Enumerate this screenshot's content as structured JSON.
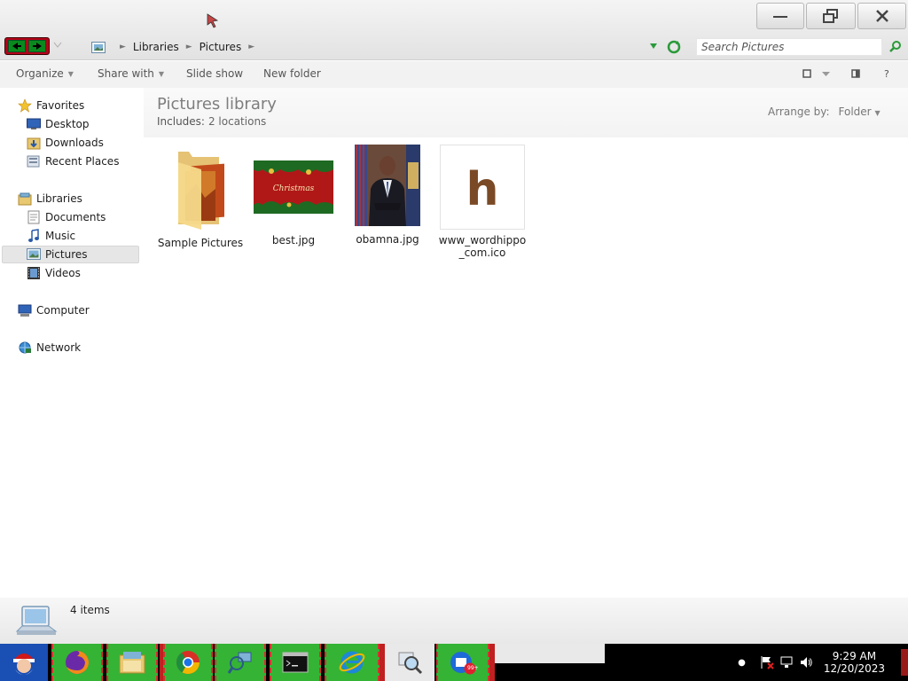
{
  "window": {
    "address": {
      "crumbs": [
        "Libraries",
        "Pictures"
      ]
    },
    "search_placeholder": "Search Pictures",
    "buttons": [
      "minimize-icon",
      "restore-icon",
      "close-icon"
    ]
  },
  "toolbar": {
    "organize": "Organize",
    "share_with": "Share with",
    "slide_show": "Slide show",
    "new_folder": "New folder",
    "help": "?"
  },
  "nav": {
    "favorites": "Favorites",
    "desktop": "Desktop",
    "downloads": "Downloads",
    "recent_places": "Recent Places",
    "libraries": "Libraries",
    "documents": "Documents",
    "music": "Music",
    "pictures": "Pictures",
    "videos": "Videos",
    "computer": "Computer",
    "network": "Network"
  },
  "library": {
    "title": "Pictures library",
    "includes_label": "Includes:",
    "includes_value": "2 locations",
    "arrange_label": "Arrange by:",
    "arrange_value": "Folder"
  },
  "files": [
    {
      "name": "Sample Pictures"
    },
    {
      "name": "best.jpg",
      "thumb_text": "Christmas"
    },
    {
      "name": "obamna.jpg"
    },
    {
      "name_line1": "www_wordhippo",
      "name_line2": "_com.ico",
      "thumb_text": "h"
    }
  ],
  "details": {
    "count": "4 items"
  },
  "taskbar": {
    "time": "9:29 AM",
    "date": "12/20/2023",
    "badge": "99+"
  },
  "colors": {
    "accent_green": "#35b335",
    "start_blue": "#1a4fb4"
  }
}
